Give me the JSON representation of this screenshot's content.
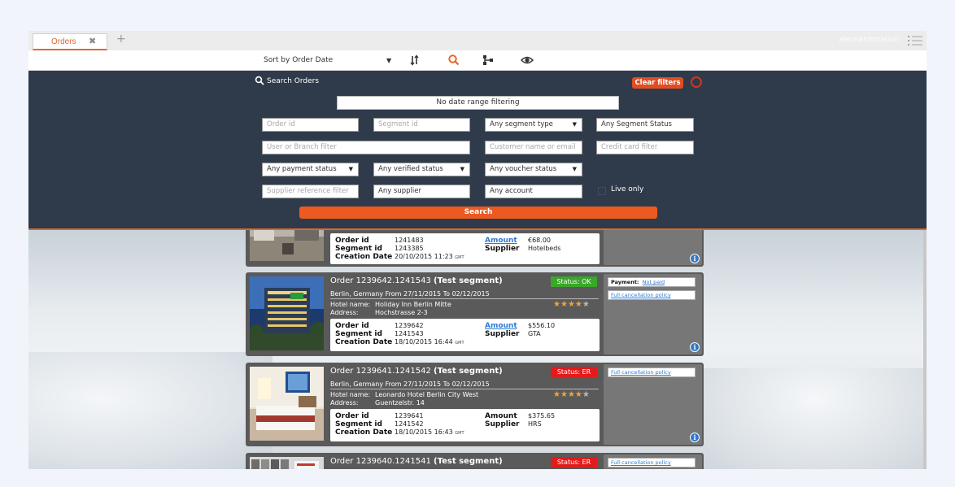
{
  "tabs": [
    {
      "label": "Orders",
      "close": "✖"
    }
  ],
  "new_tab": "+",
  "user": {
    "name": "aleonardstration"
  },
  "toolbar": {
    "sort_label": "Sort by Order Date",
    "sort_caret": "▼"
  },
  "filters": {
    "title": "Search Orders",
    "clear_label": "Clear filters",
    "date_range": "No date range filtering",
    "order_id_placeholder": "Order id",
    "segment_id_placeholder": "Segment id",
    "segment_type": "Any segment type",
    "segment_status": "Any Segment Status",
    "user_branch_placeholder": "User or Branch filter",
    "customer_placeholder": "Customer name or email",
    "credit_card_placeholder": "Credit card filter",
    "payment_status": "Any payment status",
    "verified_status": "Any verified status",
    "voucher_status": "Any voucher status",
    "supplier_ref_placeholder": "Supplier reference filter",
    "supplier": "Any supplier",
    "account": "Any account",
    "live_only": "Live only",
    "search_label": "Search"
  },
  "labels": {
    "order_id": "Order id",
    "segment_id": "Segment id",
    "creation_date": "Creation Date",
    "amount": "Amount",
    "supplier": "Supplier",
    "hotel_name": "Hotel name:",
    "address": "Address:",
    "payment": "Payment:",
    "not_paid": "Not paid",
    "full_cancellation": "Full cancellation policy",
    "gmt": "GMT"
  },
  "orders": [
    {
      "order_id": "1241483",
      "segment_id": "1243385",
      "creation_date": "20/10/2015 11:23",
      "amount": "€68.00",
      "supplier": "Hotelbeds"
    },
    {
      "title": "Order 1239642.1241543",
      "tag": "(Test segment)",
      "status": "Status: OK",
      "status_color": "#3aa62a",
      "route": "Berlin, Germany From 27/11/2015 To 02/12/2015",
      "hotel_name": "Holiday Inn Berlin Mitte",
      "address": "Hochstrasse 2-3",
      "stars": 4,
      "order_id": "1239642",
      "segment_id": "1241543",
      "creation_date": "18/10/2015 16:44",
      "amount": "$556.10",
      "supplier": "GTA"
    },
    {
      "title": "Order 1239641.1241542",
      "tag": "(Test segment)",
      "status": "Status: ER",
      "status_color": "#e21b1b",
      "route": "Berlin, Germany From 27/11/2015 To 02/12/2015",
      "hotel_name": "Leonardo Hotel Berlin City West",
      "address": "Guentzelstr. 14",
      "stars": 4,
      "order_id": "1239641",
      "segment_id": "1241542",
      "creation_date": "18/10/2015 16:43",
      "amount": "$375.65",
      "supplier": "HRS"
    },
    {
      "title": "Order 1239640.1241541",
      "tag": "(Test segment)",
      "status": "Status: ER",
      "status_color": "#e21b1b"
    }
  ]
}
